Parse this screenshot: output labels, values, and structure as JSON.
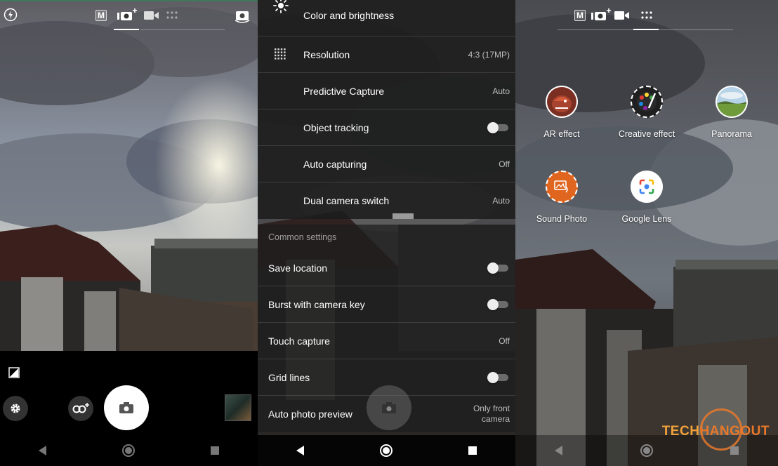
{
  "panel_settings": {
    "top_rows": [
      {
        "label": "Color and brightness",
        "icon": "brightness-icon",
        "value": ""
      },
      {
        "label": "Resolution",
        "icon": "grid-dots-icon",
        "value": "4:3 (17MP)"
      },
      {
        "label": "Predictive Capture",
        "icon": "",
        "value": "Auto"
      },
      {
        "label": "Object tracking",
        "icon": "",
        "value": "toggle-off"
      },
      {
        "label": "Auto capturing",
        "icon": "",
        "value": "Off"
      },
      {
        "label": "Dual camera switch",
        "icon": "",
        "value": "Auto"
      }
    ],
    "common_heading": "Common settings",
    "common_rows": [
      {
        "label": "Save location",
        "value": "toggle-off"
      },
      {
        "label": "Burst with camera key",
        "value": "toggle-off"
      },
      {
        "label": "Touch capture",
        "value": "Off"
      },
      {
        "label": "Grid lines",
        "value": "toggle-off"
      },
      {
        "label": "Auto photo preview",
        "value": "Only front camera"
      }
    ]
  },
  "panel_modes": {
    "modes": [
      {
        "label": "AR effect",
        "icon": "ar-effect-icon"
      },
      {
        "label": "Creative effect",
        "icon": "creative-effect-icon"
      },
      {
        "label": "Panorama",
        "icon": "panorama-icon"
      },
      {
        "label": "Sound Photo",
        "icon": "sound-photo-icon"
      },
      {
        "label": "Google Lens",
        "icon": "google-lens-icon"
      }
    ]
  },
  "top_modes": {
    "manual_label": "M"
  },
  "watermark": {
    "part1": "TECH",
    "part2": "HANGOUT",
    "color1": "#f2a23a",
    "color2": "#e8782a"
  },
  "colors": {
    "accent_white": "#ffffff",
    "toggle_track": "#6b6b6b",
    "menu_bg": "#1c1c1c"
  }
}
